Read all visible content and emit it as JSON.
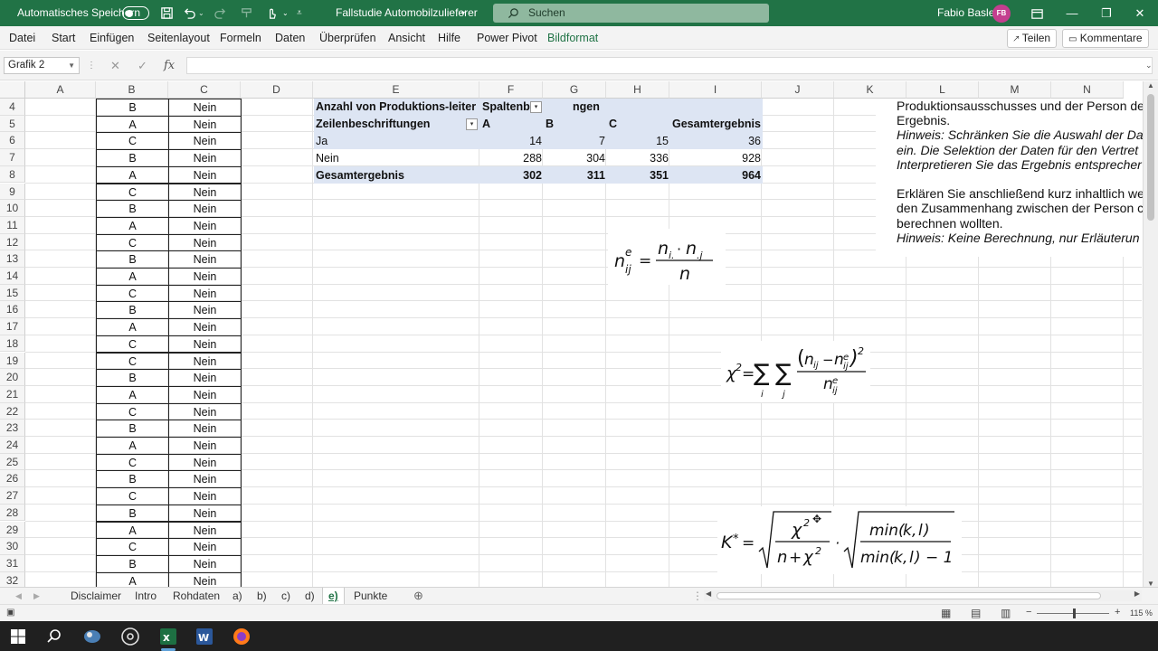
{
  "titlebar": {
    "autosave_label": "Automatisches Speichern",
    "doc_title": "Fallstudie Automobilzulieferer",
    "search_placeholder": "Suchen",
    "user_name": "Fabio Basler",
    "user_initials": "FB",
    "accent": "#217346"
  },
  "menu": {
    "items": [
      "Datei",
      "Start",
      "Einfügen",
      "Seitenlayout",
      "Formeln",
      "Daten",
      "Überprüfen",
      "Ansicht",
      "Hilfe",
      "Power Pivot",
      "Bildformat"
    ],
    "share_label": "Teilen",
    "comments_label": "Kommentare"
  },
  "formulabar": {
    "namebox": "Grafik 2",
    "fx_label": "fx",
    "value": ""
  },
  "columns": [
    "A",
    "B",
    "C",
    "D",
    "E",
    "F",
    "G",
    "H",
    "I",
    "J",
    "K",
    "L",
    "M",
    "N"
  ],
  "rows": [
    "4",
    "5",
    "6",
    "7",
    "8",
    "9",
    "10",
    "11",
    "12",
    "13",
    "14",
    "15",
    "16",
    "17",
    "18",
    "19",
    "20",
    "21",
    "22",
    "23",
    "24",
    "25",
    "26",
    "27",
    "28",
    "29",
    "30",
    "31",
    "32"
  ],
  "data_b": [
    "B",
    "A",
    "C",
    "B",
    "A",
    "C",
    "B",
    "A",
    "C",
    "B",
    "A",
    "C",
    "B",
    "A",
    "C",
    "C",
    "B",
    "A",
    "C",
    "B",
    "A",
    "C",
    "B",
    "C",
    "B",
    "A",
    "C",
    "B",
    "A"
  ],
  "data_c": [
    "Nein",
    "Nein",
    "Nein",
    "Nein",
    "Nein",
    "Nein",
    "Nein",
    "Nein",
    "Nein",
    "Nein",
    "Nein",
    "Nein",
    "Nein",
    "Nein",
    "Nein",
    "Nein",
    "Nein",
    "Nein",
    "Nein",
    "Nein",
    "Nein",
    "Nein",
    "Nein",
    "Nein",
    "Nein",
    "Nein",
    "Nein",
    "Nein",
    "Nein"
  ],
  "pivot": {
    "header_title": "Anzahl von Produktions-leiter",
    "col_field": "Spaltenbe",
    "col_field_tail": "ngen",
    "row_field": "Zeilenbeschriftungen",
    "col_labels": [
      "A",
      "B",
      "C"
    ],
    "grand_total_label": "Gesamtergebnis",
    "rows": [
      {
        "label": "Ja",
        "values": [
          "14",
          "7",
          "15",
          "36"
        ]
      },
      {
        "label": "Nein",
        "values": [
          "288",
          "304",
          "336",
          "928"
        ]
      }
    ],
    "total_row": {
      "label": "Gesamtergebnis",
      "values": [
        "302",
        "311",
        "351",
        "964"
      ]
    },
    "band_color": "#dde5f3"
  },
  "instructions": [
    {
      "text": "Produktionsausschusses und der Person de",
      "italic": false
    },
    {
      "text": "Ergebnis.",
      "italic": false
    },
    {
      "text": "Hinweis: Schränken Sie die Auswahl der Da",
      "italic": true
    },
    {
      "text": "ein. Die Selektion der Daten für den Vertret",
      "italic": true
    },
    {
      "text": "Interpretieren Sie das Ergebnis entsprecher",
      "italic": true
    },
    {
      "text": "",
      "italic": false
    },
    {
      "text": "Erklären Sie anschließend kurz inhaltlich we",
      "italic": false
    },
    {
      "text": "den Zusammenhang zwischen der Person c",
      "italic": false
    },
    {
      "text": "berechnen wollten.",
      "italic": false
    },
    {
      "text": "Hinweis: Keine Berechnung, nur Erläuterun",
      "italic": true
    }
  ],
  "sheet_tabs": [
    "Disclaimer",
    "Intro",
    "Rohdaten",
    "a)",
    "b)",
    "c)",
    "d)",
    "e)",
    "Punkte"
  ],
  "active_tab": "e)",
  "status": {
    "zoom": "115 %"
  }
}
